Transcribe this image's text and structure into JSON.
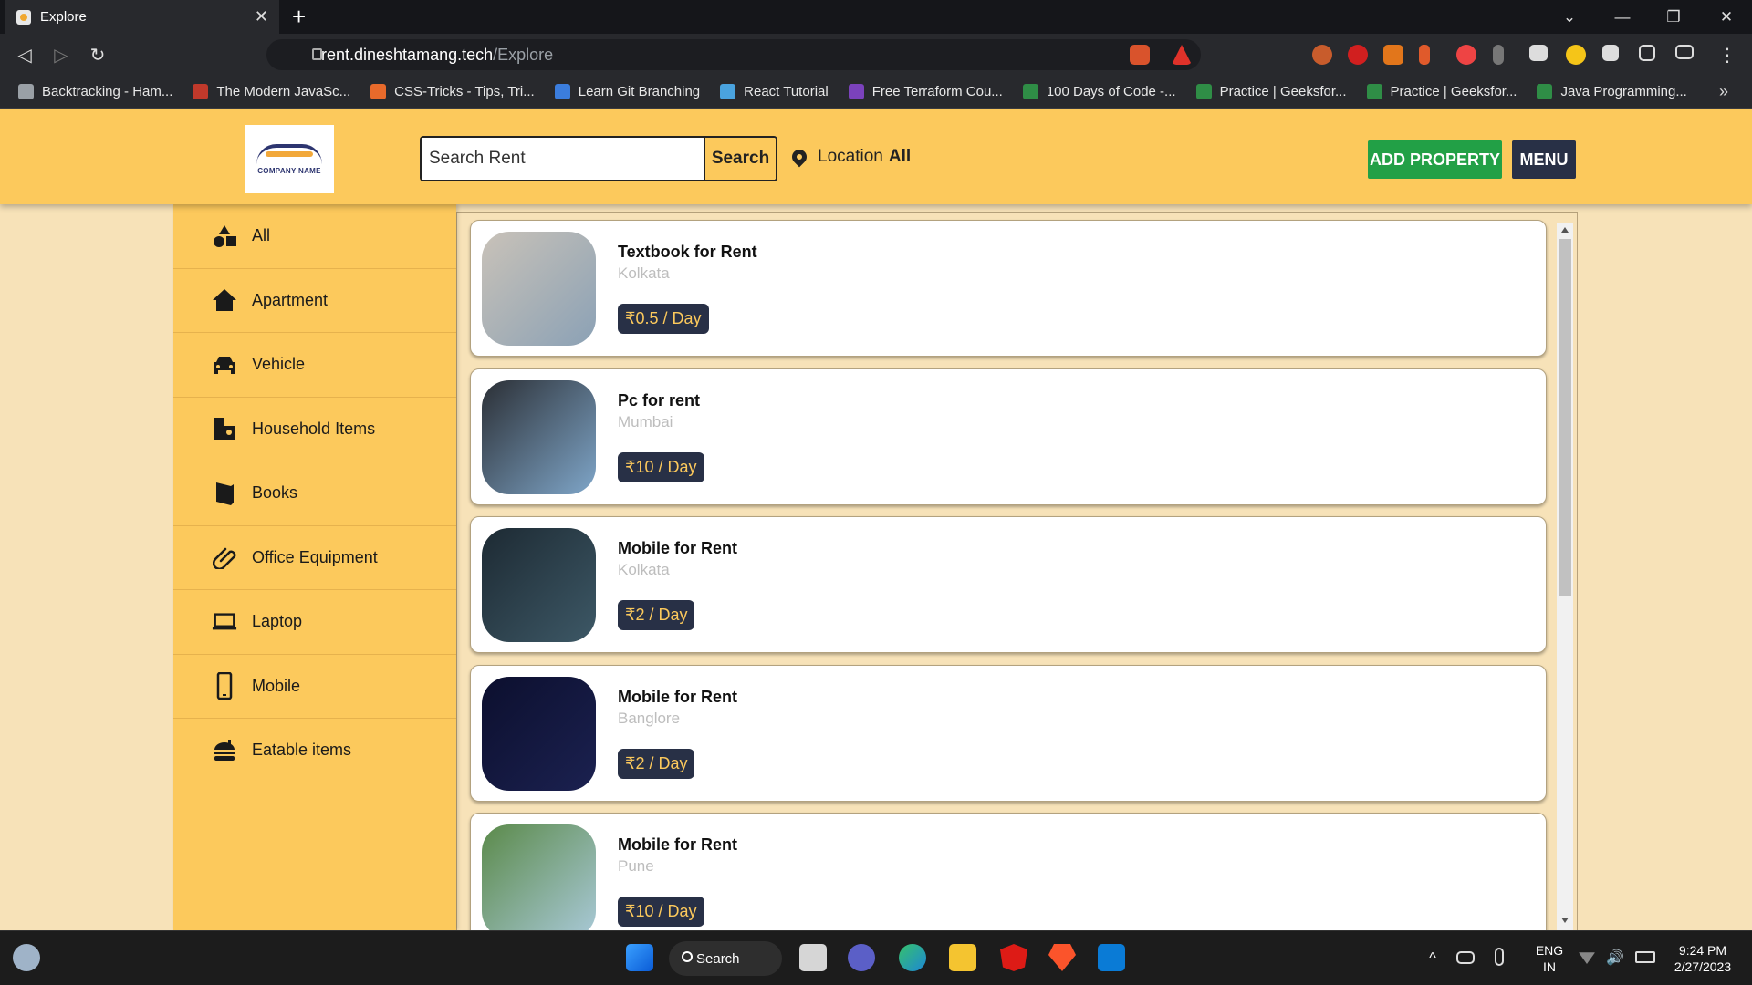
{
  "browser": {
    "tab_title": "Explore",
    "new_tab": "+",
    "url_host": "rent.dineshtamang.tech",
    "url_path": "/Explore",
    "bookmarks": [
      {
        "label": "Backtracking - Ham...",
        "color": "#9aa0a6"
      },
      {
        "label": "The Modern JavaSc...",
        "color": "#c0392b"
      },
      {
        "label": "CSS-Tricks - Tips, Tri...",
        "color": "#e86a2b"
      },
      {
        "label": "Learn Git Branching",
        "color": "#3b7ddd"
      },
      {
        "label": "React Tutorial",
        "color": "#4aa3df"
      },
      {
        "label": "Free Terraform Cou...",
        "color": "#7b42bc"
      },
      {
        "label": "100 Days of Code -...",
        "color": "#2f8d46"
      },
      {
        "label": "Practice | Geeksfor...",
        "color": "#2f8d46"
      },
      {
        "label": "Practice | Geeksfor...",
        "color": "#2f8d46"
      },
      {
        "label": "Java Programming...",
        "color": "#2f8d46"
      }
    ],
    "more": "»"
  },
  "header": {
    "logo_text": "COMPANY NAME",
    "search_placeholder": "Search Rent",
    "search_button": "Search",
    "location_label": "Location",
    "location_value": "All",
    "add_property": "ADD PROPERTY",
    "menu": "MENU"
  },
  "categories": [
    {
      "label": "All",
      "icon": "shapes-icon"
    },
    {
      "label": "Apartment",
      "icon": "home-icon"
    },
    {
      "label": "Vehicle",
      "icon": "car-icon"
    },
    {
      "label": "Household Items",
      "icon": "household-icon"
    },
    {
      "label": "Books",
      "icon": "book-icon"
    },
    {
      "label": "Office Equipment",
      "icon": "paperclip-icon"
    },
    {
      "label": "Laptop",
      "icon": "laptop-icon"
    },
    {
      "label": "Mobile",
      "icon": "mobile-icon"
    },
    {
      "label": "Eatable items",
      "icon": "burger-icon"
    }
  ],
  "listings": [
    {
      "title": "Textbook for Rent",
      "location": "Kolkata",
      "price": "₹0.5 / Day",
      "thumb_colors": [
        "#c9c2b8",
        "#8ba1b5"
      ]
    },
    {
      "title": "Pc for rent",
      "location": "Mumbai",
      "price": "₹10 / Day",
      "thumb_colors": [
        "#2b2f35",
        "#7fa6c9"
      ]
    },
    {
      "title": "Mobile for Rent",
      "location": "Kolkata",
      "price": "₹2 / Day",
      "thumb_colors": [
        "#1d2a33",
        "#3d5866"
      ]
    },
    {
      "title": "Mobile for Rent",
      "location": "Banglore",
      "price": "₹2 / Day",
      "thumb_colors": [
        "#0c0f2e",
        "#1b2150"
      ]
    },
    {
      "title": "Mobile for Rent",
      "location": "Pune",
      "price": "₹10 / Day",
      "thumb_colors": [
        "#5b8a4a",
        "#a9c9d8"
      ]
    }
  ],
  "taskbar": {
    "search": "Search",
    "lang_top": "ENG",
    "lang_bottom": "IN",
    "time": "9:24 PM",
    "date": "2/27/2023"
  },
  "colors": {
    "header_bg": "#fcc95c",
    "page_bg": "#f7e2b8",
    "price_bg": "#283046",
    "add_property_bg": "#22a046"
  }
}
